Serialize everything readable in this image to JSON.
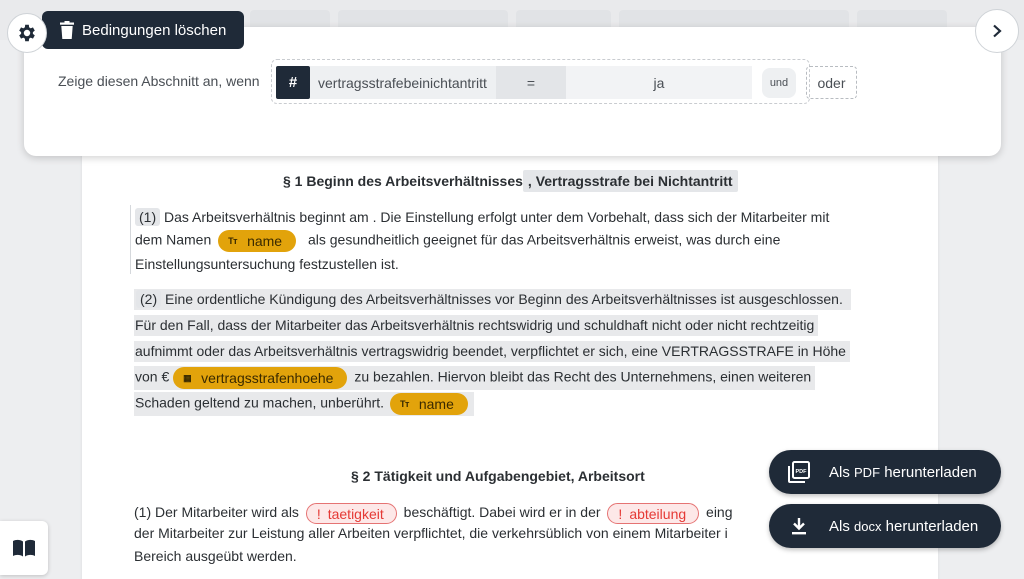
{
  "condition": {
    "clear_label": "Bedingungen löschen",
    "show_label": "Zeige diesen Abschnitt an, wenn",
    "var_badge": "#",
    "variable": "vertragsstrafebeinichtantritt",
    "operator": "=",
    "value": "ja",
    "and_label": "und",
    "or_label": "oder"
  },
  "doc": {
    "s1": {
      "heading": "§ 1 Beginn des Arbeitsverhältnisses",
      "heading_extra": ", Vertragsstrafe bei Nichtantritt",
      "p1": {
        "num": "(1)",
        "l1": "Das Arbeitsverhältnis beginnt am  . Die Einstellung erfolgt unter dem Vorbehalt, dass sich der Mitarbeiter mit",
        "l2_pre": "dem Namen",
        "chip_name": "name",
        "l2_post": "als gesundheitlich geeignet für das Arbeitsverhältnis erweist, was durch eine",
        "l3": "Einstellungsuntersuchung festzustellen ist."
      },
      "p2": {
        "num": "(2)",
        "l1": "Eine ordentliche Kündigung des Arbeitsverhältnisses vor Beginn des Arbeitsverhältnisses ist ausgeschlossen.",
        "l2": "Für den Fall, dass der Mitarbeiter das Arbeitsverhältnis rechtswidrig und schuldhaft nicht oder nicht rechtzeitig",
        "l3": "aufnimmt oder das Arbeitsverhältnis vertragswidrig beendet, verpflichtet er sich, eine VERTRAGSSTRAFE in Höhe",
        "l4_pre": "von €",
        "chip_amount": "vertragsstrafenhoehe",
        "l4_post": "zu bezahlen. Hiervon bleibt das Recht des Unternehmens, einen weiteren",
        "l5": "Schaden geltend zu machen, unberührt.",
        "chip_name": "name"
      }
    },
    "s2": {
      "heading": "§ 2 Tätigkeit und Aufgabengebiet, Arbeitsort",
      "p1": {
        "l1_pre": "(1) Der Mitarbeiter wird als",
        "chip_job": "taetigkeit",
        "l1_mid": "beschäftigt. Dabei wird er in der",
        "chip_dept": "abteilung",
        "l1_post": "eing",
        "l2": "der Mitarbeiter zur Leistung aller Arbeiten verpflichtet, die verkehrsüblich von einem Mitarbeiter i",
        "l3": "Bereich ausgeübt werden."
      }
    }
  },
  "downloads": {
    "pdf_pre": "Als",
    "pdf_fmt": "PDF",
    "pdf_post": "herunterladen",
    "docx_pre": "Als",
    "docx_fmt": "docx",
    "docx_post": "herunterladen"
  },
  "icons": {
    "gear": "gear-icon",
    "trash": "trash-icon",
    "next": "chevron-right-icon",
    "text_type": "Tт",
    "number_type": "number-icon",
    "warning": "!",
    "pdf": "pdf-icon",
    "download": "download-icon",
    "book": "book-icon"
  },
  "colors": {
    "dark": "#1f2a38",
    "chip": "#e2a30b",
    "warn": "#e53935"
  }
}
